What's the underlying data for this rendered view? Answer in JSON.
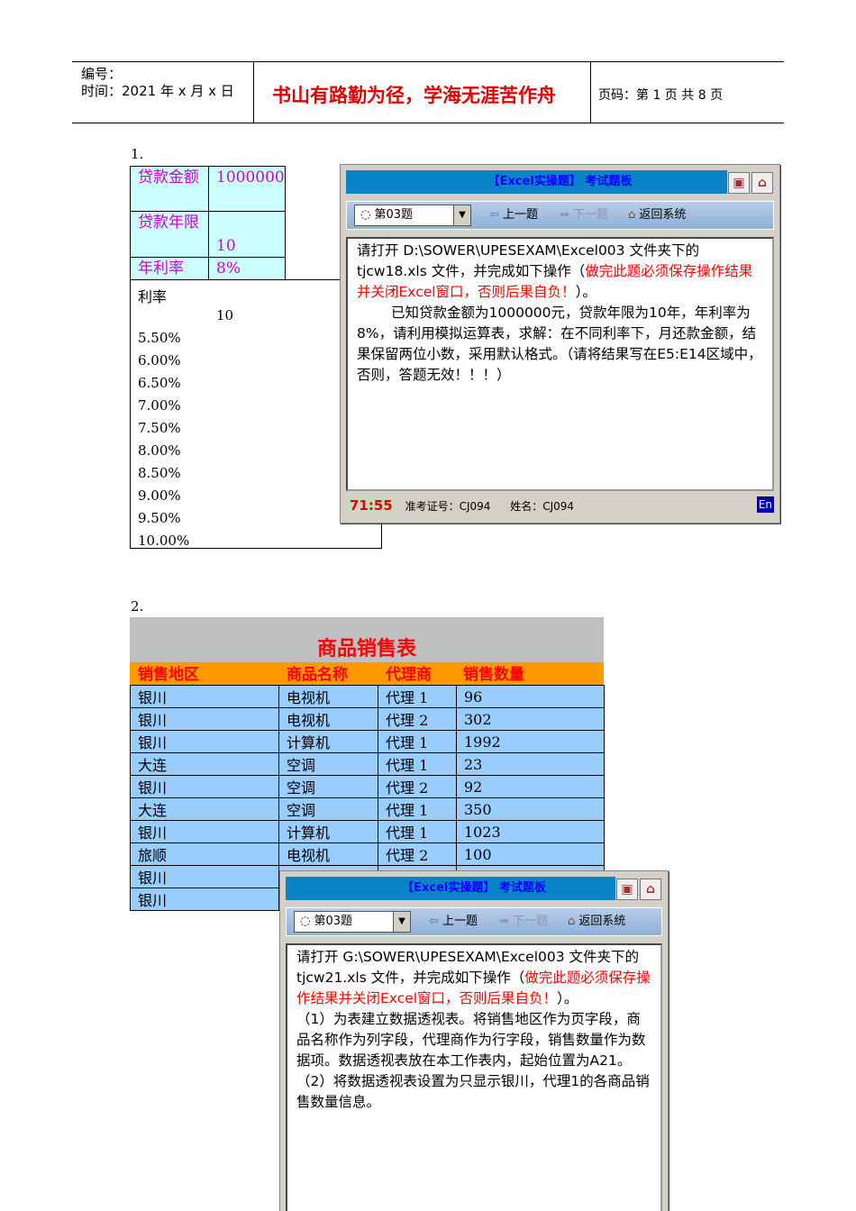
{
  "header": {
    "number_label": "编号：",
    "time_label": "时间：2021 年 x 月 x 日",
    "motto": "书山有路勤为径，学海无涯苦作舟",
    "page_label": "页码：第 1 页  共 8 页"
  },
  "q1": {
    "number": "1.",
    "cells": {
      "loan_amount_label": "贷款金额",
      "loan_amount": "1000000",
      "years_label": "贷款年限",
      "years": "10",
      "rate_label": "年利率",
      "rate": "8%"
    },
    "rate_header": "利率",
    "years_value": "10",
    "rates": [
      "5.50%",
      "6.00%",
      "6.50%",
      "7.00%",
      "7.50%",
      "8.00%",
      "8.50%",
      "9.00%",
      "9.50%",
      "10.00%"
    ],
    "window": {
      "title": "【Excel实操题】 考试题板",
      "question_select": "第03题",
      "prev": "上一题",
      "next": "下一题",
      "home": "返回系统",
      "text_a": "请打开 D:\\SOWER\\UPESEXAM\\Excel003 文件夹下的 tjcw18.xls 文件，并完成如下操作（",
      "text_red": "做完此题必须保存操作结果并关闭Excel窗口，否则后果自负！",
      "text_b": "）。",
      "text_c": "已知贷款金额为1000000元，贷款年限为10年，年利率为8%，请利用模拟运算表，求解：在不同利率下，月还款金额，结果保留两位小数，采用默认格式。（请将结果写在E5:E14区域中，否则，答题无效！！！）",
      "timer": "71:55",
      "exam_id": "准考证号：CJ094",
      "name": "姓名：CJ094",
      "ime": "En"
    }
  },
  "q2": {
    "number": "2.",
    "table_title": "商品销售表",
    "columns": [
      "销售地区",
      "商品名称",
      "代理商",
      "销售数量"
    ],
    "rows": [
      [
        "银川",
        "电视机",
        "代理 1",
        "96"
      ],
      [
        "银川",
        "电视机",
        "代理 2",
        "302"
      ],
      [
        "银川",
        "计算机",
        "代理 1",
        "1992"
      ],
      [
        "大连",
        "空调",
        "代理 1",
        "23"
      ],
      [
        "银川",
        "空调",
        "代理 2",
        "92"
      ],
      [
        "大连",
        "空调",
        "代理 1",
        "350"
      ],
      [
        "银川",
        "计算机",
        "代理 1",
        "1023"
      ],
      [
        "旅顺",
        "电视机",
        "代理 2",
        "100"
      ],
      [
        "银川",
        "",
        "",
        ""
      ],
      [
        "银川",
        "",
        "",
        ""
      ]
    ],
    "window": {
      "title": "【Excel实操题】 考试题板",
      "question_select": "第03题",
      "prev": "上一题",
      "next": "下一题",
      "home": "返回系统",
      "text_a": "请打开 G:\\SOWER\\UPESEXAM\\Excel003 文件夹下的 tjcw21.xls 文件，并完成如下操作（",
      "text_red": "做完此题必须保存操作结果并关闭Excel窗口，否则后果自负！",
      "text_b": "）。",
      "step1": "（1）为表建立数据透视表。将销售地区作为页字段，商品名称作为列字段，代理商作为行字段，销售数量作为数据项。数据透视表放在本工作表内，起始位置为A21。",
      "step2": "（2）将数据透视表设置为只显示银川，代理1的各商品销售数量信息。"
    }
  }
}
